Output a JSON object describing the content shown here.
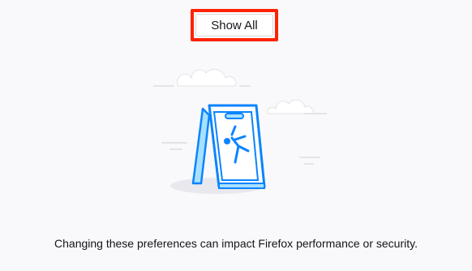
{
  "buttons": {
    "show_all_label": "Show All"
  },
  "message": {
    "warning": "Changing these preferences can impact Firefox performance or security."
  },
  "colors": {
    "highlight_border": "#ff2200",
    "illustration_blue": "#0a84ff",
    "illustration_light_blue": "#a7e1ff",
    "background": "#f9f9fb"
  },
  "illustration": {
    "icon": "wet-floor-sign-icon"
  }
}
